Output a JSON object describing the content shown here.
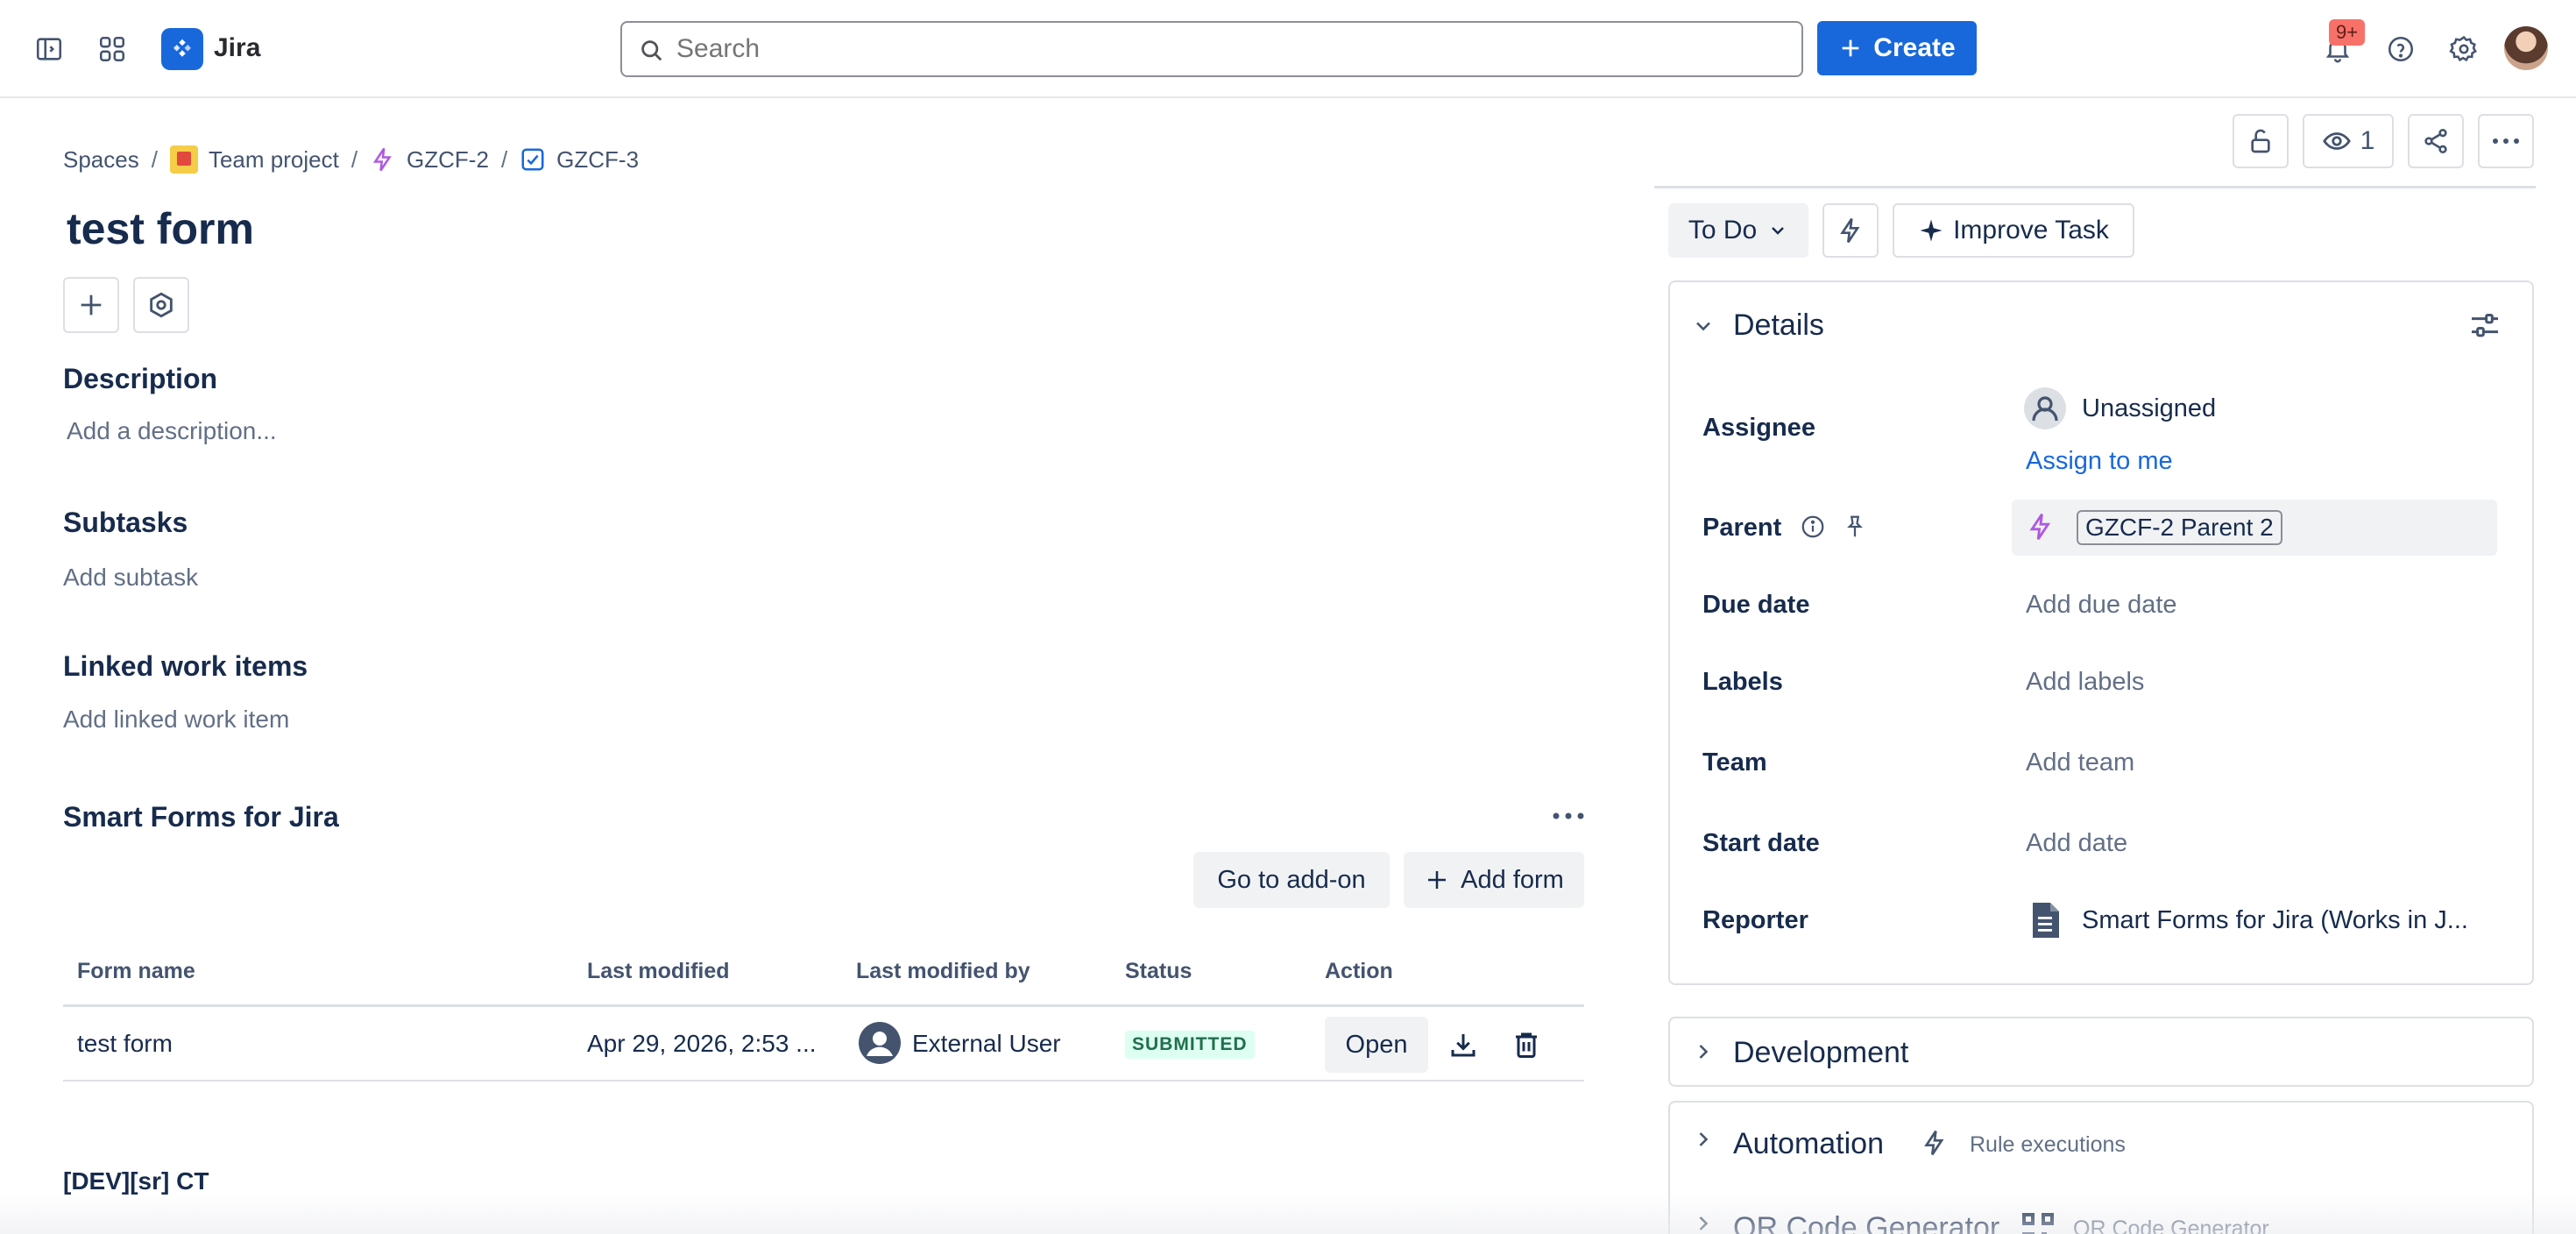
{
  "nav": {
    "brand": "Jira",
    "search_placeholder": "Search",
    "create_label": "Create",
    "notifications_count": "9+"
  },
  "breadcrumb": {
    "items": [
      "Spaces",
      "Team project",
      "GZCF-2",
      "GZCF-3"
    ]
  },
  "issue": {
    "title": "test form"
  },
  "description": {
    "heading": "Description",
    "placeholder": "Add a description..."
  },
  "subtasks": {
    "heading": "Subtasks",
    "action": "Add subtask"
  },
  "linked": {
    "heading": "Linked work items",
    "action": "Add linked work item"
  },
  "smart_forms": {
    "heading": "Smart Forms for Jira",
    "go_to_addon": "Go to add-on",
    "add_form": "Add form",
    "columns": [
      "Form name",
      "Last modified",
      "Last modified by",
      "Status",
      "Action"
    ],
    "rows": [
      {
        "form_name": "test form",
        "last_modified": "Apr 29, 2026, 2:53 ...",
        "last_modified_by": "External User",
        "status": "SUBMITTED",
        "action": "Open"
      }
    ]
  },
  "dev_section": {
    "heading": "[DEV][sr] CT"
  },
  "right_panel": {
    "watchers_count": "1",
    "status": "To Do",
    "improve_task": "Improve Task",
    "details": {
      "heading": "Details",
      "fields": {
        "assignee_label": "Assignee",
        "assignee_value": "Unassigned",
        "assign_to_me": "Assign to me",
        "parent_label": "Parent",
        "parent_value": "GZCF-2 Parent 2",
        "due_date_label": "Due date",
        "due_date_value": "Add due date",
        "labels_label": "Labels",
        "labels_value": "Add labels",
        "team_label": "Team",
        "team_value": "Add team",
        "start_date_label": "Start date",
        "start_date_value": "Add date",
        "reporter_label": "Reporter",
        "reporter_value": "Smart Forms for Jira (Works in J..."
      }
    },
    "development": {
      "heading": "Development"
    },
    "automation": {
      "heading": "Automation",
      "sub": "Rule executions"
    },
    "qr": {
      "heading": "QR Code Generator",
      "sub": "QR Code Generator"
    }
  },
  "colors": {
    "brand_blue": "#1868db",
    "lozenge_green_bg": "#dcfff1",
    "lozenge_green_text": "#216e4e",
    "badge_red": "#f87168"
  }
}
